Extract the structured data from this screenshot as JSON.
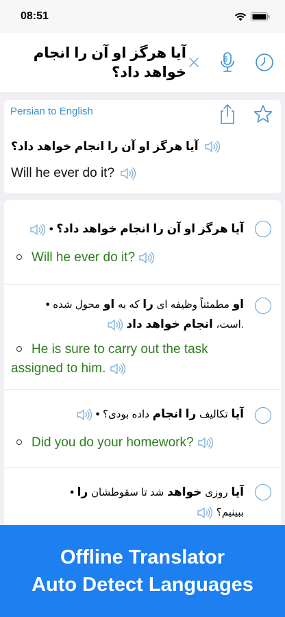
{
  "status_bar": {
    "time": "08:51"
  },
  "search": {
    "query": "آیا هرگز او آن را انجام خواهد داد؟"
  },
  "result": {
    "language_pair": "Persian to English",
    "source": "آیا هرگز او آن را انجام خواهد داد؟",
    "translation": "Will he ever do it?"
  },
  "examples": [
    {
      "source_html": "• <b>آیا هرگز او آن را انجام خواهد داد؟</b>",
      "translation": "Will he ever do it?"
    },
    {
      "source_html": "<b>او</b> <span class=\"plain\">مطمئناً وظیفه ای</span> <b>را</b> <span class=\"plain\">که به</span> <b>او</b> <span class=\"plain\">محول شده</span> •<br><span class=\"plain\">.است،</span> <b>انجام خواهد داد</b>",
      "translation": "He is sure to carry out the task assigned to him."
    },
    {
      "source_html": "<b>آیا</b> <span class=\"plain\">تکالیف</span> <b>را انجام</b> <span class=\"plain\">داده بودی؟</span> •",
      "translation": "Did you do your homework?"
    },
    {
      "source_html": "<b>آیا</b> <span class=\"plain\">روزی</span> <b>خواهد</b> <span class=\"plain\">شد تا سقوطشان</span> <b>را</b> •<br><span class=\"plain\">ببینیم؟</span>",
      "translation": ""
    }
  ],
  "promo": {
    "line1": "Offline Translator",
    "line2": "Auto Detect Languages"
  },
  "colors": {
    "accent": "#3a8fd0",
    "translation_green": "#2e7d1e",
    "promo_bg": "#1d7ff0"
  },
  "icons": [
    "wifi-icon",
    "battery-icon",
    "close-icon",
    "microphone-icon",
    "history-clock-icon",
    "share-icon",
    "star-icon",
    "speaker-icon"
  ]
}
